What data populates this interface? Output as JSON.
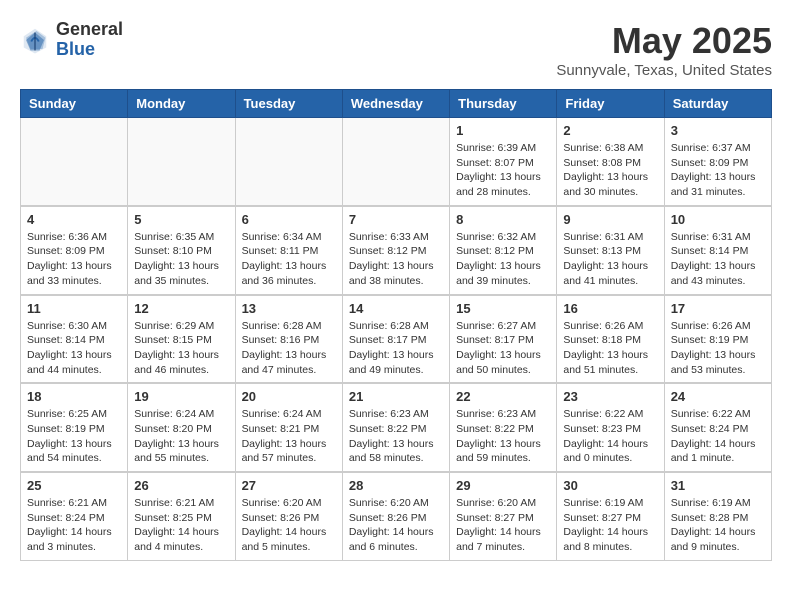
{
  "header": {
    "logo_general": "General",
    "logo_blue": "Blue",
    "month_title": "May 2025",
    "location": "Sunnyvale, Texas, United States"
  },
  "days_of_week": [
    "Sunday",
    "Monday",
    "Tuesday",
    "Wednesday",
    "Thursday",
    "Friday",
    "Saturday"
  ],
  "weeks": [
    [
      {
        "day": "",
        "info": ""
      },
      {
        "day": "",
        "info": ""
      },
      {
        "day": "",
        "info": ""
      },
      {
        "day": "",
        "info": ""
      },
      {
        "day": "1",
        "info": "Sunrise: 6:39 AM\nSunset: 8:07 PM\nDaylight: 13 hours\nand 28 minutes."
      },
      {
        "day": "2",
        "info": "Sunrise: 6:38 AM\nSunset: 8:08 PM\nDaylight: 13 hours\nand 30 minutes."
      },
      {
        "day": "3",
        "info": "Sunrise: 6:37 AM\nSunset: 8:09 PM\nDaylight: 13 hours\nand 31 minutes."
      }
    ],
    [
      {
        "day": "4",
        "info": "Sunrise: 6:36 AM\nSunset: 8:09 PM\nDaylight: 13 hours\nand 33 minutes."
      },
      {
        "day": "5",
        "info": "Sunrise: 6:35 AM\nSunset: 8:10 PM\nDaylight: 13 hours\nand 35 minutes."
      },
      {
        "day": "6",
        "info": "Sunrise: 6:34 AM\nSunset: 8:11 PM\nDaylight: 13 hours\nand 36 minutes."
      },
      {
        "day": "7",
        "info": "Sunrise: 6:33 AM\nSunset: 8:12 PM\nDaylight: 13 hours\nand 38 minutes."
      },
      {
        "day": "8",
        "info": "Sunrise: 6:32 AM\nSunset: 8:12 PM\nDaylight: 13 hours\nand 39 minutes."
      },
      {
        "day": "9",
        "info": "Sunrise: 6:31 AM\nSunset: 8:13 PM\nDaylight: 13 hours\nand 41 minutes."
      },
      {
        "day": "10",
        "info": "Sunrise: 6:31 AM\nSunset: 8:14 PM\nDaylight: 13 hours\nand 43 minutes."
      }
    ],
    [
      {
        "day": "11",
        "info": "Sunrise: 6:30 AM\nSunset: 8:14 PM\nDaylight: 13 hours\nand 44 minutes."
      },
      {
        "day": "12",
        "info": "Sunrise: 6:29 AM\nSunset: 8:15 PM\nDaylight: 13 hours\nand 46 minutes."
      },
      {
        "day": "13",
        "info": "Sunrise: 6:28 AM\nSunset: 8:16 PM\nDaylight: 13 hours\nand 47 minutes."
      },
      {
        "day": "14",
        "info": "Sunrise: 6:28 AM\nSunset: 8:17 PM\nDaylight: 13 hours\nand 49 minutes."
      },
      {
        "day": "15",
        "info": "Sunrise: 6:27 AM\nSunset: 8:17 PM\nDaylight: 13 hours\nand 50 minutes."
      },
      {
        "day": "16",
        "info": "Sunrise: 6:26 AM\nSunset: 8:18 PM\nDaylight: 13 hours\nand 51 minutes."
      },
      {
        "day": "17",
        "info": "Sunrise: 6:26 AM\nSunset: 8:19 PM\nDaylight: 13 hours\nand 53 minutes."
      }
    ],
    [
      {
        "day": "18",
        "info": "Sunrise: 6:25 AM\nSunset: 8:19 PM\nDaylight: 13 hours\nand 54 minutes."
      },
      {
        "day": "19",
        "info": "Sunrise: 6:24 AM\nSunset: 8:20 PM\nDaylight: 13 hours\nand 55 minutes."
      },
      {
        "day": "20",
        "info": "Sunrise: 6:24 AM\nSunset: 8:21 PM\nDaylight: 13 hours\nand 57 minutes."
      },
      {
        "day": "21",
        "info": "Sunrise: 6:23 AM\nSunset: 8:22 PM\nDaylight: 13 hours\nand 58 minutes."
      },
      {
        "day": "22",
        "info": "Sunrise: 6:23 AM\nSunset: 8:22 PM\nDaylight: 13 hours\nand 59 minutes."
      },
      {
        "day": "23",
        "info": "Sunrise: 6:22 AM\nSunset: 8:23 PM\nDaylight: 14 hours\nand 0 minutes."
      },
      {
        "day": "24",
        "info": "Sunrise: 6:22 AM\nSunset: 8:24 PM\nDaylight: 14 hours\nand 1 minute."
      }
    ],
    [
      {
        "day": "25",
        "info": "Sunrise: 6:21 AM\nSunset: 8:24 PM\nDaylight: 14 hours\nand 3 minutes."
      },
      {
        "day": "26",
        "info": "Sunrise: 6:21 AM\nSunset: 8:25 PM\nDaylight: 14 hours\nand 4 minutes."
      },
      {
        "day": "27",
        "info": "Sunrise: 6:20 AM\nSunset: 8:26 PM\nDaylight: 14 hours\nand 5 minutes."
      },
      {
        "day": "28",
        "info": "Sunrise: 6:20 AM\nSunset: 8:26 PM\nDaylight: 14 hours\nand 6 minutes."
      },
      {
        "day": "29",
        "info": "Sunrise: 6:20 AM\nSunset: 8:27 PM\nDaylight: 14 hours\nand 7 minutes."
      },
      {
        "day": "30",
        "info": "Sunrise: 6:19 AM\nSunset: 8:27 PM\nDaylight: 14 hours\nand 8 minutes."
      },
      {
        "day": "31",
        "info": "Sunrise: 6:19 AM\nSunset: 8:28 PM\nDaylight: 14 hours\nand 9 minutes."
      }
    ]
  ]
}
